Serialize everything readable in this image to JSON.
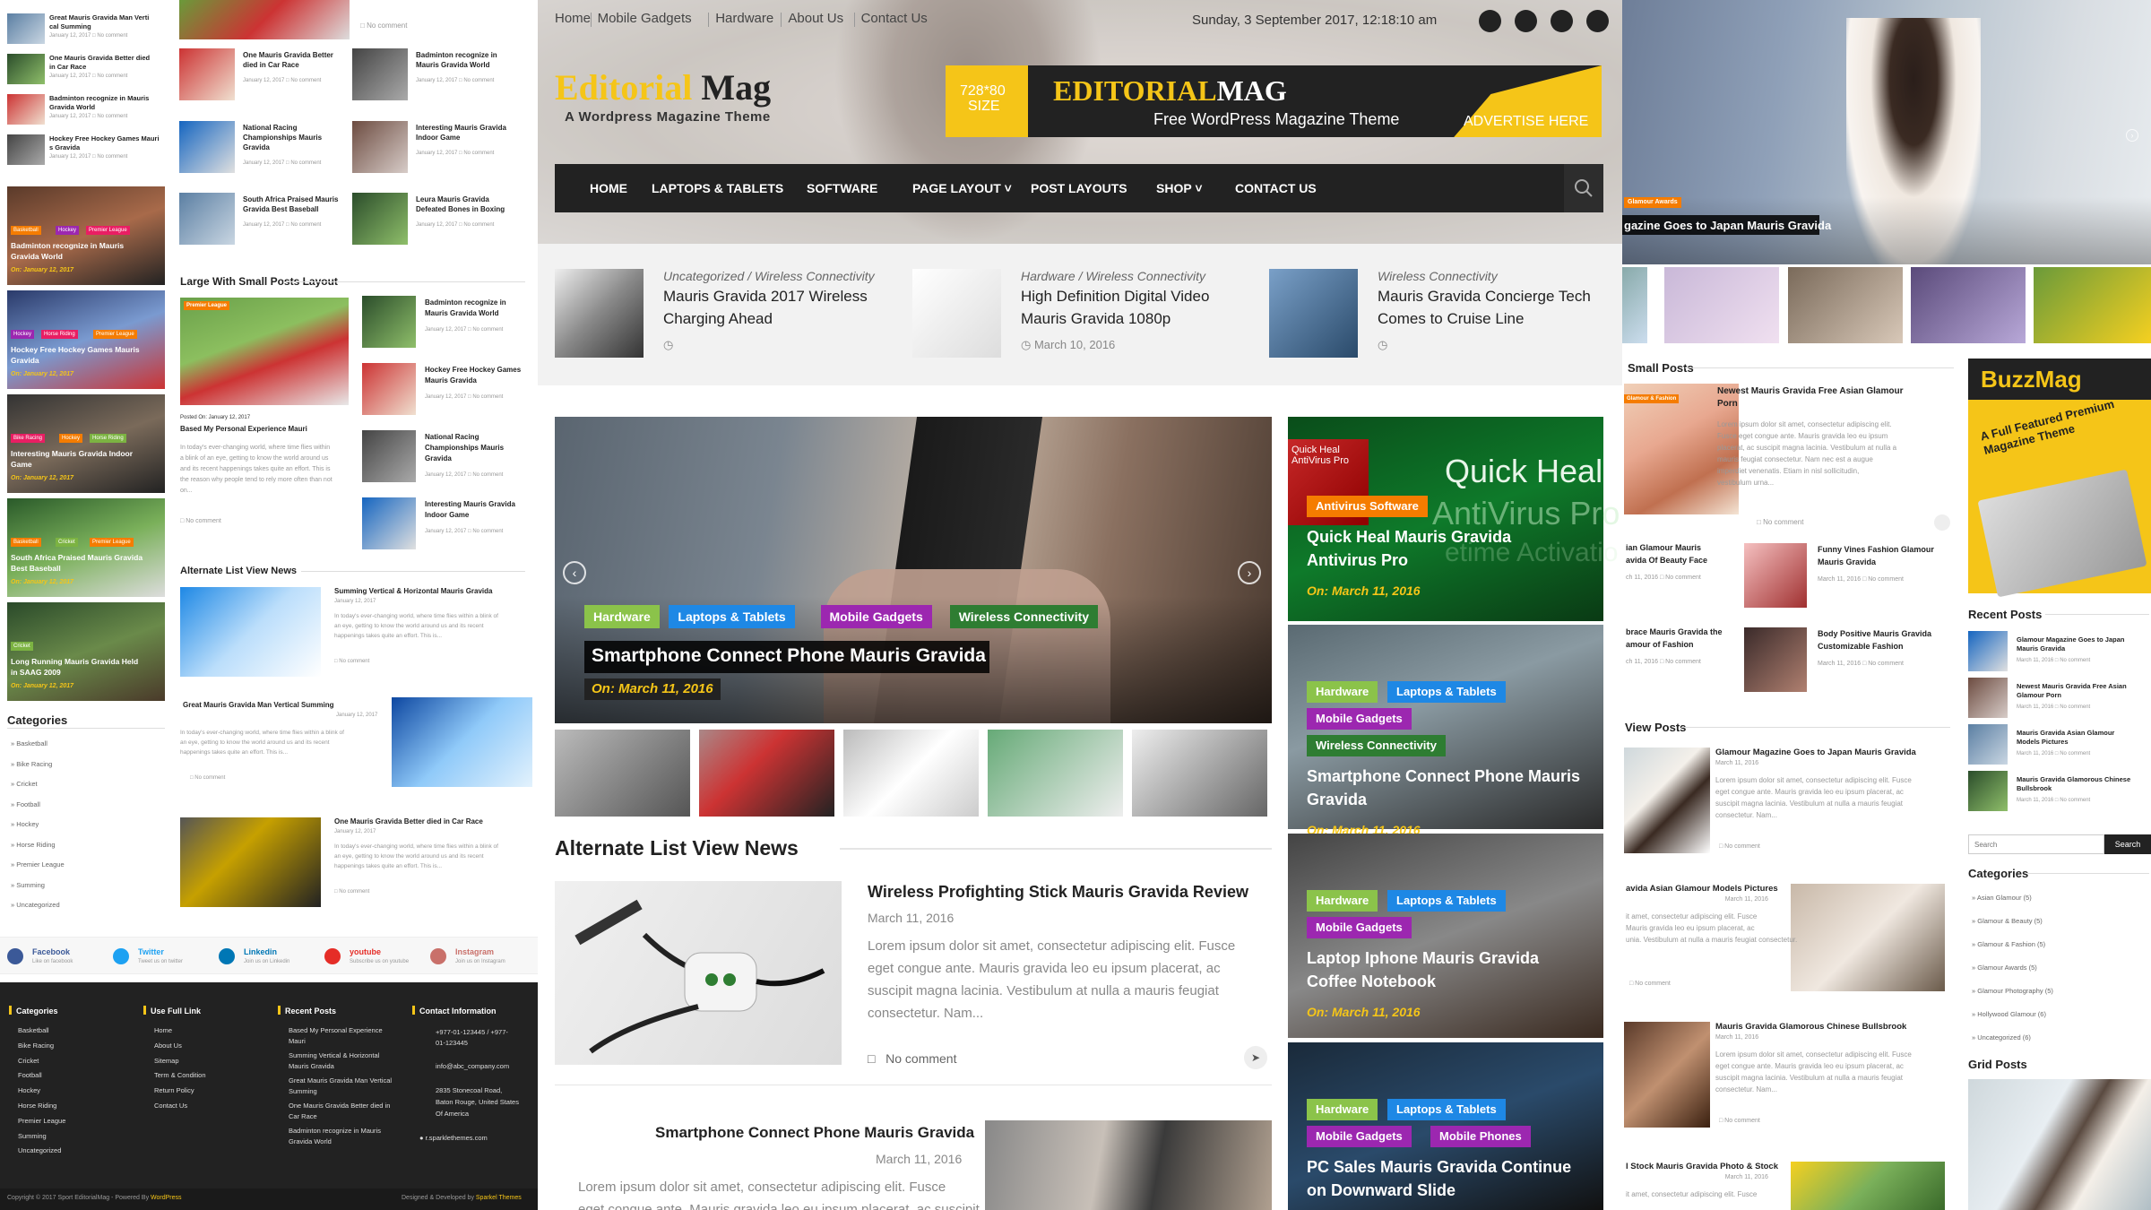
{
  "topbar": {
    "links": [
      "Home",
      "Mobile Gadgets",
      "Hardware",
      "About Us",
      "Contact Us"
    ],
    "date": "Sunday, 3 September 2017, 12:18:10 am",
    "social": [
      "facebook-icon",
      "twitter-icon",
      "youtube-icon",
      "linkedin-icon"
    ]
  },
  "logo": {
    "part1": "Editorial",
    "part2": "Mag",
    "tagline": "A Wordpress Magazine Theme"
  },
  "ad": {
    "size_line1": "728*80",
    "size_line2": "SIZE",
    "brand1": "EDITORIAL",
    "brand2": "MAG",
    "subtitle": "Free WordPress Magazine Theme",
    "cta": "ADVERTISE HERE"
  },
  "nav": {
    "items": [
      "HOME",
      "LAPTOPS & TABLETS",
      "SOFTWARE",
      "PAGE LAYOUT",
      "POST LAYOUTS",
      "SHOP",
      "CONTACT US"
    ],
    "dropdown_flags": [
      false,
      false,
      false,
      true,
      false,
      true,
      false
    ]
  },
  "ticker": [
    {
      "cat": "Uncategorized / Wireless Connectivity",
      "title1": "Mauris Gravida 2017 Wireless",
      "title2": "Charging Ahead",
      "date": ""
    },
    {
      "cat": "Hardware / Wireless Connectivity",
      "title1": "High Definition Digital Video",
      "title2": "Mauris Gravida 1080p",
      "date": "March 10, 2016"
    },
    {
      "cat": "Wireless Connectivity",
      "title1": "Mauris Gravida Concierge Tech",
      "title2": "Comes to Cruise Line",
      "date": ""
    }
  ],
  "slider": {
    "cats": [
      "Hardware",
      "Laptops & Tablets",
      "Mobile Gadgets",
      "Wireless Connectivity"
    ],
    "cat_colors": [
      "#8bc34a",
      "#1e88e5",
      "#9c27b0",
      "#2e7d32"
    ],
    "title": "Smartphone Connect Phone Mauris Gravida",
    "date": "On: March 11, 2016",
    "prev_icon": "chevron-left-icon",
    "next_icon": "chevron-right-icon"
  },
  "side_cards": [
    {
      "cats": [
        "Antivirus Software"
      ],
      "title1": "Quick Heal Mauris Gravida",
      "title2": "Antivirus Pro",
      "date": "On: March 11, 2016",
      "bg_text1": "Quick Heal",
      "bg_text2": "AntiVirus Pro",
      "bg_text3": "etime Activatio",
      "box_text": "Quick Heal AntiVirus Pro"
    },
    {
      "cats": [
        "Hardware",
        "Laptops & Tablets",
        "Mobile Gadgets",
        "Wireless Connectivity"
      ],
      "title1": "Smartphone Connect Phone Mauris",
      "title2": "Gravida",
      "date": "On: March 11, 2016"
    },
    {
      "cats": [
        "Hardware",
        "Laptops & Tablets",
        "Mobile Gadgets"
      ],
      "title1": "Laptop Iphone Mauris Gravida",
      "title2": "Coffee Notebook",
      "date": "On: March 11, 2016"
    },
    {
      "cats": [
        "Hardware",
        "Laptops & Tablets",
        "Mobile Gadgets",
        "Mobile Phones"
      ],
      "title1": "PC Sales Mauris Gravida Continue",
      "title2": "on Downward Slide",
      "date": ""
    }
  ],
  "alt_list": {
    "heading": "Alternate List View News",
    "post1": {
      "title": "Wireless Profighting Stick Mauris Gravida Review",
      "date": "March 11, 2016",
      "excerpt": [
        "Lorem ipsum dolor sit amet, consectetur adipiscing elit. Fusce",
        "eget congue ante. Mauris gravida leo eu ipsum placerat, ac",
        "suscipit magna lacinia. Vestibulum at nulla a mauris feugiat",
        "consectetur. Nam..."
      ],
      "comments": "No comment"
    },
    "post2": {
      "title": "Smartphone Connect Phone Mauris Gravida",
      "date": "March 11, 2016",
      "excerpt": [
        "Lorem ipsum dolor sit amet, consectetur adipiscing elit. Fusce",
        "eget congue ante. Mauris gravida leo eu ipsum placerat, ac suscipit"
      ]
    }
  },
  "left_col": {
    "mini_list": [
      {
        "title": "Great Mauris Gravida Man Vertical Summing",
        "date": "January 12, 2017",
        "c": "No comment"
      },
      {
        "title": "One Mauris Gravida Better died in Car Race",
        "date": "January 12, 2017",
        "c": "No comment"
      },
      {
        "title": "Badminton recognize in Mauris Gravida World",
        "date": "January 12, 2017",
        "c": "No comment"
      },
      {
        "title": "Hockey Free Hockey Games Mauris Gravida",
        "date": "January 12, 2017",
        "c": "No comment"
      }
    ],
    "image_cards": [
      {
        "tags": [
          "Basketball",
          "Hockey",
          "Premier League"
        ],
        "title1": "Badminton recognize in Mauris",
        "title2": "Gravida World",
        "date": "On: January 12, 2017"
      },
      {
        "tags": [
          "Hockey",
          "Horse Riding",
          "Premier League"
        ],
        "title1": "Hockey Free Hockey Games Mauris",
        "title2": "Gravida",
        "date": "On: January 12, 2017"
      },
      {
        "tags": [
          "Bike Racing",
          "Hockey",
          "Horse Riding"
        ],
        "title1": "Interesting Mauris Gravida Indoor",
        "title2": "Game",
        "date": "On: January 12, 2017"
      },
      {
        "tags": [
          "Basketball",
          "Cricket",
          "Premier League"
        ],
        "title1": "South Africa Praised Mauris Gravida",
        "title2": "Best Baseball",
        "date": "On: January 12, 2017"
      },
      {
        "tags": [
          "Cricket"
        ],
        "title1": "Long Running Mauris Gravida Held",
        "title2": "in SAAG 2009",
        "date": "On: January 12, 2017"
      }
    ],
    "categories_heading": "Categories",
    "categories": [
      "Basketball",
      "Bike Racing",
      "Cricket",
      "Football",
      "Hockey",
      "Horse Riding",
      "Premier League",
      "Summing",
      "Uncategorized"
    ]
  },
  "mid_col": {
    "grid_posts": [
      {
        "title1": "One Mauris Gravida Better",
        "title2": "died in Car Race",
        "date": "January 12, 2017",
        "c": "No comment"
      },
      {
        "title1": "Badminton recognize in",
        "title2": "Mauris Gravida World",
        "date": "January 12, 2017",
        "c": "No comment"
      },
      {
        "title1": "National Racing",
        "title2": "Championships Mauris",
        "title3": "Gravida",
        "date": "January 12, 2017",
        "c": "No comment"
      },
      {
        "title1": "Interesting Mauris Gravida",
        "title2": "Indoor Game",
        "date": "January 12, 2017",
        "c": "No comment"
      },
      {
        "title1": "South Africa Praised Mauris",
        "title2": "Gravida Best Baseball",
        "date": "January 12, 2017",
        "c": "No comment"
      },
      {
        "title1": "Leura Mauris Gravida",
        "title2": "Defeated Bones in Boxing",
        "date": "January 12, 2017",
        "c": "No comment"
      }
    ],
    "top_comment": "No comment",
    "lsp_heading": "Large With Small Posts Layout",
    "lsp_big": {
      "posted": "Posted On: January 12, 2017",
      "title": "Based My Personal Experience Mauri",
      "excerpt": [
        "In today's ever-changing world, where time flies within",
        "a blink of an eye, getting to know the world around us",
        "and its recent happenings takes quite an effort. This is",
        "the reason why people tend to rely more often than not",
        "on..."
      ],
      "c": "No comment",
      "tag": "Premier League"
    },
    "lsp_small": [
      {
        "title1": "Badminton recognize in",
        "title2": "Mauris Gravida World",
        "date": "January 12, 2017",
        "c": "No comment"
      },
      {
        "title1": "Hockey Free Hockey Games",
        "title2": "Mauris Gravida",
        "date": "January 12, 2017",
        "c": "No comment"
      },
      {
        "title1": "National Racing",
        "title2": "Championships Mauris",
        "title3": "Gravida",
        "date": "January 12, 2017",
        "c": "No comment"
      },
      {
        "title1": "Interesting Mauris Gravida",
        "title2": "Indoor Game",
        "date": "January 12, 2017",
        "c": "No comment"
      }
    ],
    "alt_heading": "Alternate List View News",
    "alt_posts": [
      {
        "title": "Summing Vertical & Horizontal Mauris Gravida",
        "date": "January 12, 2017",
        "excerpt": [
          "In today's ever-changing world, where time flies within a blink of",
          "an eye, getting to know the world around us and its recent",
          "happenings takes quite an effort. This is..."
        ],
        "c": "No comment"
      },
      {
        "title": "Great Mauris Gravida Man Vertical Summing",
        "date": "January 12, 2017",
        "excerpt": [
          "In today's ever-changing world, where time flies within a blink of",
          "an eye, getting to know the world around us and its recent",
          "happenings takes quite an effort. This is..."
        ],
        "c": "No comment"
      },
      {
        "title": "One Mauris Gravida Better died in Car Race",
        "date": "January 12, 2017",
        "excerpt": [
          "In today's ever-changing world, where time flies within a blink of",
          "an eye, getting to know the world around us and its recent",
          "happenings takes quite an effort. This is..."
        ],
        "c": "No comment"
      }
    ]
  },
  "social_row": [
    {
      "name": "Facebook",
      "sub": "Like on facebook",
      "color": "#3b5998"
    },
    {
      "name": "Twitter",
      "sub": "Tweet us on twitter",
      "color": "#1da1f2"
    },
    {
      "name": "Linkedin",
      "sub": "Join us on Linkedin",
      "color": "#0077b5"
    },
    {
      "name": "youtube",
      "sub": "Subscribe us on youtube",
      "color": "#e52d27"
    },
    {
      "name": "Instagram",
      "sub": "Join us on Instagram",
      "color": "#c9706a"
    }
  ],
  "footer": {
    "categories_heading": "Categories",
    "categories": [
      "Basketball",
      "Bike Racing",
      "Cricket",
      "Football",
      "Hockey",
      "Horse Riding",
      "Premier League",
      "Summing",
      "Uncategorized"
    ],
    "links_heading": "Use Full Link",
    "links": [
      "Home",
      "About Us",
      "Sitemap",
      "Term & Condition",
      "Return Policy",
      "Contact Us"
    ],
    "recent_heading": "Recent Posts",
    "recent": [
      [
        "Based My Personal Experience",
        "Mauri"
      ],
      [
        "Summing Vertical & Horizontal",
        "Mauris Gravida"
      ],
      [
        "Great Mauris Gravida Man Vertical",
        "Summing"
      ],
      [
        "One Mauris Gravida Better died in",
        "Car Race"
      ],
      [
        "Badminton recognize in Mauris",
        "Gravida World"
      ]
    ],
    "contact_heading": "Contact Information",
    "phone1": "+977-01-123445 / +977-",
    "phone2": "01-123445",
    "email": "info@abc_company.com",
    "address1": "2835 Stonecoal Road,",
    "address2": "Baton Rouge, United States",
    "address3": "Of America",
    "website": "r.sparklethemes.com",
    "copyright": "Copyright © 2017 Sport EditorialMag - Powered By ",
    "copyright_link": "WordPress",
    "designed": "Designed & Developed by ",
    "designed_link": "Sparkel Themes"
  },
  "right_col": {
    "hero_caption": "gazine Goes to Japan Mauris Gravida",
    "hero_tag": "Glamour Awards",
    "small_posts_heading": "Small Posts",
    "sp_main": {
      "title1": "Newest Mauris Gravida Free Asian Glamour",
      "title2": "Porn",
      "excerpt": [
        "Lorem ipsum dolor sit amet, consectetur adipiscing elit.",
        "Fusce eget congue ante. Mauris gravida leo eu ipsum",
        "placerat, ac suscipit magna lacinia. Vestibulum at nulla a",
        "mauris feugiat consectetur. Nam nec est a augue",
        "imperdiet venenatis. Etiam in nisl sollicitudin,",
        "vestibulum urna..."
      ],
      "c": "No comment"
    },
    "sp_small": [
      {
        "t1": "ian Glamour Mauris",
        "t2": "avida Of Beauty Face",
        "date": "ch 11, 2016",
        "c": "No comment"
      },
      {
        "t1": "Funny Vines Fashion Glamour",
        "t2": "Mauris Gravida",
        "date": "March 11, 2016",
        "c": "No comment"
      },
      {
        "t1": "brace Mauris Gravida the",
        "t2": "amour of Fashion",
        "date": "ch 11, 2016",
        "c": "No comment"
      },
      {
        "t1": "Body Positive Mauris Gravida",
        "t2": "Customizable Fashion",
        "date": "March 11, 2016",
        "c": "No comment"
      }
    ],
    "list_heading": "View Posts",
    "lv": [
      {
        "title": "Glamour Magazine Goes to Japan Mauris Gravida",
        "date": "March 11, 2016",
        "excerpt": [
          "Lorem ipsum dolor sit amet, consectetur adipiscing elit. Fusce",
          "eget congue ante. Mauris gravida leo eu ipsum placerat, ac",
          "suscipit magna lacinia. Vestibulum at nulla a mauris feugiat",
          "consectetur. Nam..."
        ],
        "c": "No comment"
      },
      {
        "title": "avida Asian Glamour Models Pictures",
        "date": "March 11, 2016",
        "excerpt": [
          "it amet, consectetur adipiscing elit. Fusce",
          "Mauris gravida leo eu ipsum placerat, ac",
          "unia. Vestibulum at nulla a mauris feugiat consectetur."
        ],
        "c": "No comment"
      },
      {
        "title": "Mauris Gravida Glamorous Chinese Bullsbrook",
        "date": "March 11, 2016",
        "excerpt": [
          "Lorem ipsum dolor sit amet, consectetur adipiscing elit. Fusce",
          "eget congue ante. Mauris gravida leo eu ipsum placerat, ac",
          "suscipit magna lacinia. Vestibulum at nulla a mauris feugiat",
          "consectetur. Nam..."
        ],
        "c": "No comment"
      },
      {
        "title": "l Stock Mauris Gravida Photo & Stock",
        "date": "March 11, 2016",
        "excerpt": [
          "it amet, consectetur adipiscing elit. Fusce"
        ],
        "c": ""
      }
    ],
    "buzz": {
      "brand": "BuzzMag",
      "tagline1": "A Full Featured Premium",
      "tagline2": "Magazine Theme"
    },
    "recent_heading": "Recent Posts",
    "recent": [
      {
        "t1": "Glamour Magazine Goes to Japan",
        "t2": "Mauris Gravida",
        "date": "March 11, 2016",
        "c": "No comment"
      },
      {
        "t1": "Newest Mauris Gravida Free Asian",
        "t2": "Glamour Porn",
        "date": "March 11, 2016",
        "c": "No comment"
      },
      {
        "t1": "Mauris Gravida Asian Glamour",
        "t2": "Models Pictures",
        "date": "March 11, 2016",
        "c": "No comment"
      },
      {
        "t1": "Mauris Gravida Glamorous Chinese",
        "t2": "Bullsbrook",
        "date": "March 11, 2016",
        "c": "No comment"
      }
    ],
    "search_placeholder": "Search",
    "search_button": "Search",
    "categories_heading": "Categories",
    "categories": [
      "Asian Glamour (5)",
      "Glamour & Beauty (5)",
      "Glamour & Fashion (5)",
      "Glamour Awards (5)",
      "Glamour Photography (5)",
      "Hollywood Glamour (6)",
      "Uncategorized (6)"
    ],
    "grid_heading": "Grid Posts"
  }
}
